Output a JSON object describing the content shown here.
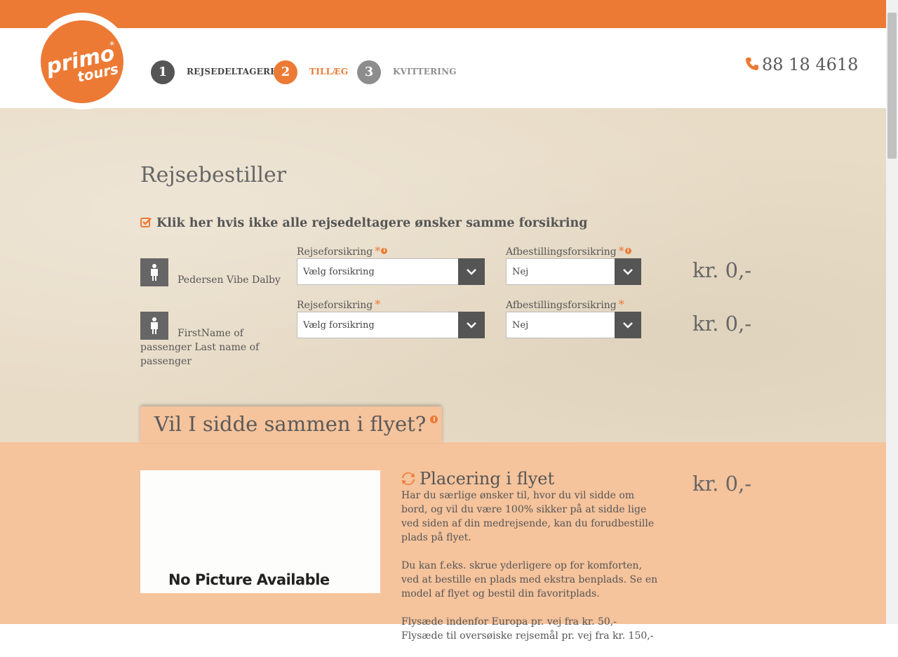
{
  "brand": {
    "logo_word1": "primo",
    "logo_word2": "tours",
    "accent_color": "#ec7a35"
  },
  "steps": [
    {
      "number": "1",
      "label": "REJSEDELTAGERE",
      "state": "completed"
    },
    {
      "number": "2",
      "label": "TILLÆG",
      "state": "active"
    },
    {
      "number": "3",
      "label": "KVITTERING",
      "state": "upcoming"
    }
  ],
  "contact": {
    "phone": "88 18 4618",
    "icon": "phone-icon"
  },
  "booker": {
    "title": "Rejsebestiller",
    "same_insurance_label": "Klik her hvis ikke alle rejsedeltagere ønsker samme forsikring",
    "passengers": [
      {
        "name": "Pedersen Vibe Dalby",
        "travel_insurance_label": "Rejseforsikring",
        "travel_insurance_value": "Vælg forsikring",
        "cancellation_label": "Afbestillingsforsikring",
        "cancellation_value": "Nej",
        "price": "kr. 0,-"
      },
      {
        "name": "FirstName of passenger Last name of passenger",
        "travel_insurance_label": "Rejseforsikring",
        "travel_insurance_value": "Vælg forsikring",
        "cancellation_label": "Afbestillingsforsikring",
        "cancellation_value": "Nej",
        "price": "kr. 0,-"
      }
    ]
  },
  "seating": {
    "tab_title": "Vil I sidde sammen i flyet?",
    "image_placeholder": "No Picture Available",
    "heading": "Placering i flyet",
    "paragraphs": [
      "Har du særlige ønsker til, hvor du vil sidde om bord, og vil du være 100% sikker på at sidde lige ved siden af din medrejsende, kan du forudbestille plads på flyet.",
      "Du kan f.eks. skrue yderligere op for komforten, ved at bestille en plads med ekstra benplads. Se en model af flyet og bestil din favoritplads.",
      "Flysæde indenfor Europa pr. vej fra kr. 50,- Flysæde til oversøiske rejsemål pr. vej fra kr. 150,-"
    ],
    "price": "kr. 0,-"
  }
}
